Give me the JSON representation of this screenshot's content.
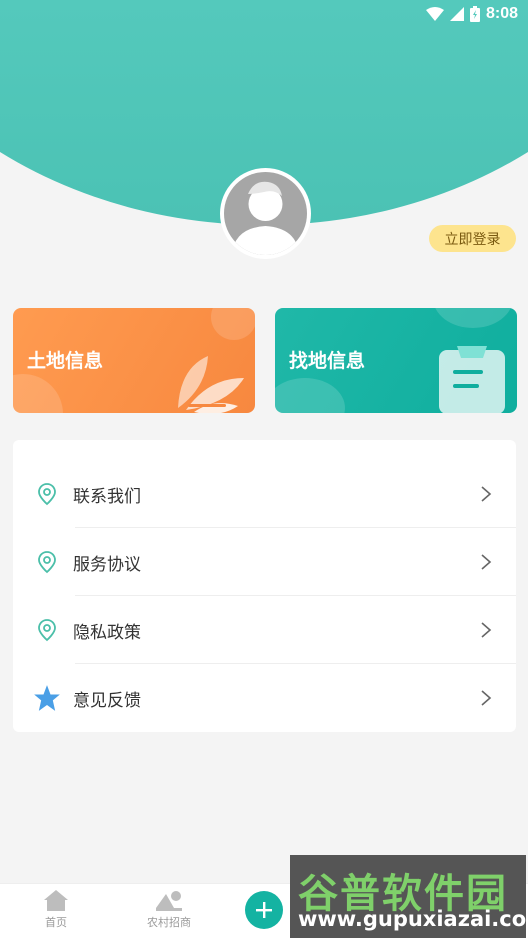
{
  "status": {
    "time": "8:08"
  },
  "profile": {
    "login_label": "立即登录"
  },
  "cards": [
    {
      "title": "土地信息",
      "color": "#f7883f"
    },
    {
      "title": "找地信息",
      "color": "#0fae9e"
    }
  ],
  "menu": {
    "items": [
      {
        "label": "联系我们",
        "icon": "location-pin-icon"
      },
      {
        "label": "服务协议",
        "icon": "location-pin-icon"
      },
      {
        "label": "隐私政策",
        "icon": "location-pin-icon"
      },
      {
        "label": "意见反馈",
        "icon": "star-icon"
      }
    ]
  },
  "tabbar": {
    "items": [
      {
        "label": "首页",
        "icon": "home-icon"
      },
      {
        "label": "农村招商",
        "icon": "village-icon"
      }
    ],
    "fab_icon": "plus-icon"
  },
  "watermark": {
    "line1": "谷普软件园",
    "line2": "www.gupuxiazai.com"
  },
  "colors": {
    "accent": "#14b3a2",
    "orange": "#f7883f",
    "login_bg": "#fde48e"
  }
}
